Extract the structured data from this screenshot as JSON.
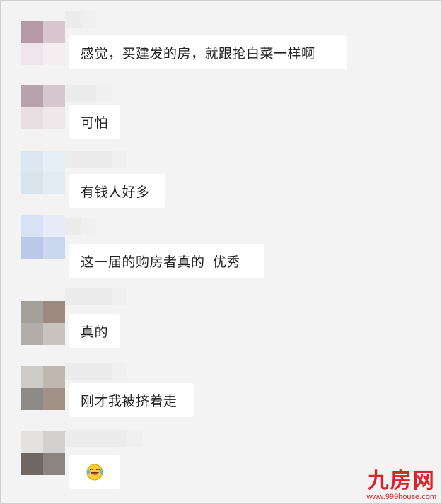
{
  "colors": {
    "background": "#f3f3f3",
    "bubble": "#ffffff",
    "text": "#222222",
    "watermark": "#d8242b"
  },
  "messages": [
    {
      "text": "感觉，买建发的房，就跟抢白菜一样啊",
      "avatar_colors": [
        "#b59aa6",
        "#d8c7cf",
        "#eee6ea",
        "#f4eef1"
      ]
    },
    {
      "text": "可怕",
      "avatar_colors": [
        "#b9a4ad",
        "#d6c8ce",
        "#e8dfe2",
        "#eee8ea"
      ]
    },
    {
      "text": "有钱人好多",
      "avatar_colors": [
        "#dce7f1",
        "#e6eff7",
        "#d9e3eb",
        "#e1ebf4"
      ]
    },
    {
      "text": "这一届的购房者真的  优秀",
      "avatar_colors": [
        "#d9e2f5",
        "#e6ecf8",
        "#b9c8e6",
        "#cbd7ee"
      ]
    },
    {
      "text": "真的",
      "avatar_colors": [
        "#a6a09a",
        "#9c8a80",
        "#b2ada8",
        "#c9c3bd"
      ]
    },
    {
      "text": "刚才我被挤着走",
      "avatar_colors": [
        "#cfcbc7",
        "#c0b7b0",
        "#8e8a85",
        "#a29186"
      ]
    },
    {
      "icon": "laughing-crying-emoji-icon",
      "avatar_colors": [
        "#e4e2e0",
        "#d4d0cd",
        "#6f6862",
        "#8c847e"
      ]
    }
  ],
  "watermark": {
    "name": "九房网",
    "url": "www.999house.com"
  }
}
